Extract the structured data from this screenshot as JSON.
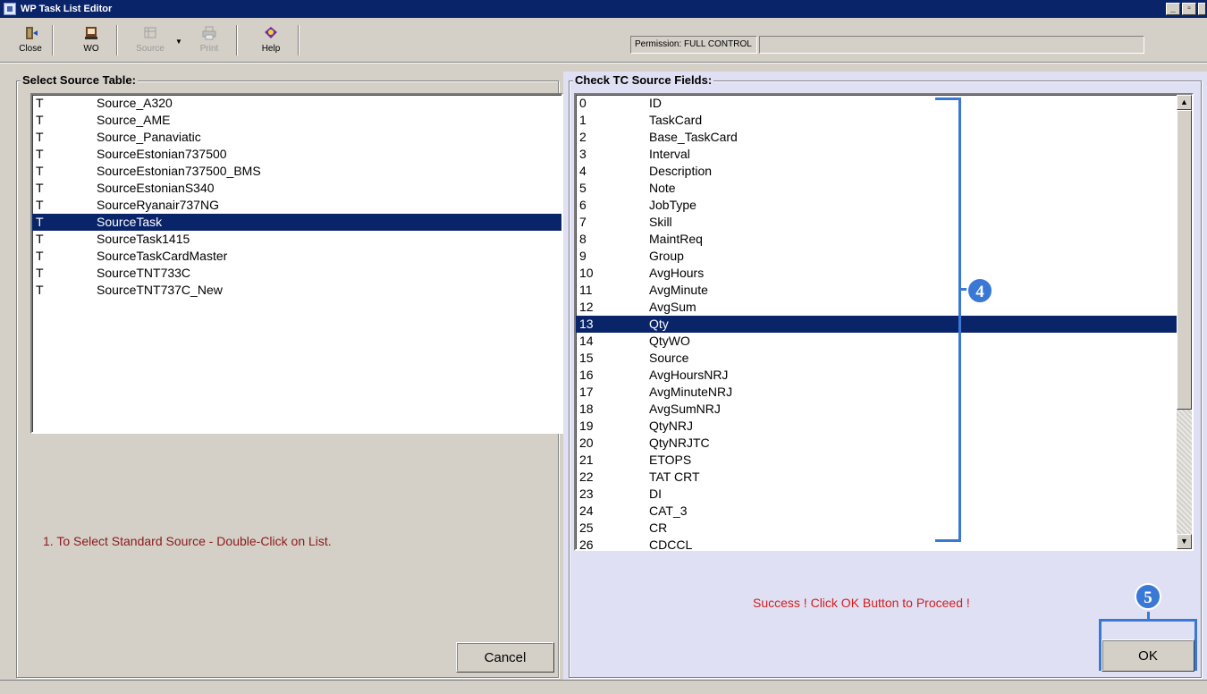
{
  "window": {
    "title": "WP Task List Editor"
  },
  "toolbar": {
    "close_label": "Close",
    "wo_label": "WO",
    "source_label": "Source",
    "print_label": "Print",
    "help_label": "Help"
  },
  "permission": {
    "label": "Permission:",
    "value": "FULL CONTROL"
  },
  "source_table": {
    "title": "Select Source Table:",
    "rows": [
      {
        "type": "T",
        "name": "Source_A320"
      },
      {
        "type": "T",
        "name": "Source_AME"
      },
      {
        "type": "T",
        "name": "Source_Panaviatic"
      },
      {
        "type": "T",
        "name": "SourceEstonian737500"
      },
      {
        "type": "T",
        "name": "SourceEstonian737500_BMS"
      },
      {
        "type": "T",
        "name": "SourceEstonianS340"
      },
      {
        "type": "T",
        "name": "SourceRyanair737NG"
      },
      {
        "type": "T",
        "name": "SourceTask"
      },
      {
        "type": "T",
        "name": "SourceTask1415"
      },
      {
        "type": "T",
        "name": "SourceTaskCardMaster"
      },
      {
        "type": "T",
        "name": "SourceTNT733C"
      },
      {
        "type": "T",
        "name": "SourceTNT737C_New"
      }
    ],
    "hint": "1. To Select Standard Source - Double-Click on List.",
    "cancel_label": "Cancel"
  },
  "source_fields": {
    "title": "Check TC Source Fields:",
    "rows": [
      {
        "index": "0",
        "name": "ID"
      },
      {
        "index": "1",
        "name": "TaskCard"
      },
      {
        "index": "2",
        "name": "Base_TaskCard"
      },
      {
        "index": "3",
        "name": "Interval"
      },
      {
        "index": "4",
        "name": "Description"
      },
      {
        "index": "5",
        "name": "Note"
      },
      {
        "index": "6",
        "name": "JobType"
      },
      {
        "index": "7",
        "name": "Skill"
      },
      {
        "index": "8",
        "name": "MaintReq"
      },
      {
        "index": "9",
        "name": "Group"
      },
      {
        "index": "10",
        "name": "AvgHours"
      },
      {
        "index": "11",
        "name": "AvgMinute"
      },
      {
        "index": "12",
        "name": "AvgSum"
      },
      {
        "index": "13",
        "name": "Qty"
      },
      {
        "index": "14",
        "name": "QtyWO"
      },
      {
        "index": "15",
        "name": "Source"
      },
      {
        "index": "16",
        "name": "AvgHoursNRJ"
      },
      {
        "index": "17",
        "name": "AvgMinuteNRJ"
      },
      {
        "index": "18",
        "name": "AvgSumNRJ"
      },
      {
        "index": "19",
        "name": "QtyNRJ"
      },
      {
        "index": "20",
        "name": "QtyNRJTC"
      },
      {
        "index": "21",
        "name": "ETOPS"
      },
      {
        "index": "22",
        "name": "TAT CRT"
      },
      {
        "index": "23",
        "name": "DI"
      },
      {
        "index": "24",
        "name": "CAT_3"
      },
      {
        "index": "25",
        "name": "CR"
      },
      {
        "index": "26",
        "name": "CDCCL"
      }
    ],
    "hint": "Success ! Click OK Button to Proceed !",
    "ok_label": "OK"
  },
  "callouts": {
    "fields_step": "4",
    "ok_step": "5"
  },
  "colors": {
    "selection": "#0a246a",
    "callout": "#3a78d6",
    "hint_left": "#8b1a1a",
    "hint_right": "#d02020"
  }
}
